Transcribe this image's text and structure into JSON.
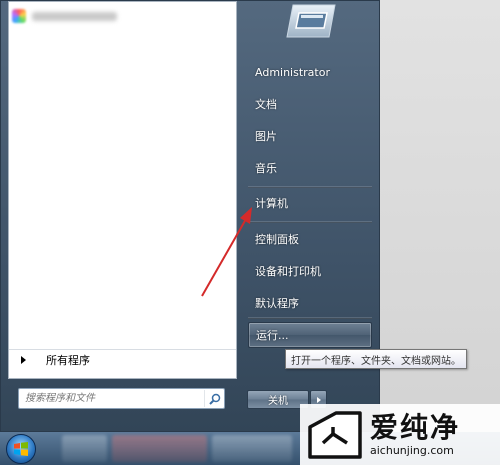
{
  "start_menu": {
    "all_programs_label": "所有程序",
    "search": {
      "placeholder": "搜索程序和文件"
    },
    "right_items": [
      {
        "label": "Administrator"
      },
      {
        "label": "文档"
      },
      {
        "label": "图片"
      },
      {
        "label": "音乐"
      },
      {
        "label": "计算机"
      },
      {
        "label": "控制面板"
      },
      {
        "label": "设备和打印机"
      },
      {
        "label": "默认程序"
      },
      {
        "label": "运行..."
      }
    ],
    "shutdown_label": "关机",
    "tooltip": "打开一个程序、文件夹、文档或网站。"
  },
  "watermark": {
    "brand": "爱纯净",
    "url": "aichunjing.com"
  },
  "colors": {
    "annotation_arrow": "#d42a2a",
    "menu_bg": "#3f5368"
  }
}
